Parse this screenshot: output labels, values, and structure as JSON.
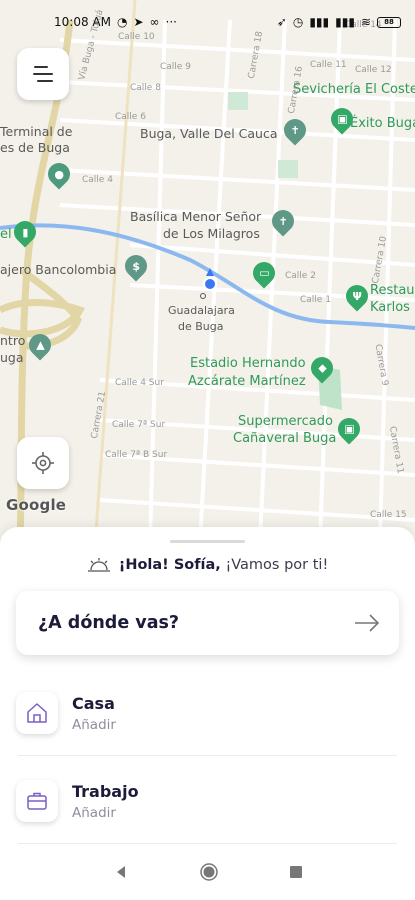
{
  "status": {
    "time": "10:08 AM",
    "battery": "88"
  },
  "map": {
    "labels": {
      "terminal": "Terminal de",
      "terminal2": "es de Buga",
      "buga_city": "Buga, Valle Del Cauca",
      "basilica1": "Basílica Menor Señor",
      "basilica2": "de Los Milagros",
      "cajero": "ajero Bancolombia",
      "guadalajara1": "Guadalajara",
      "guadalajara2": "de Buga",
      "estadio1": "Estadio Hernando",
      "estadio2": "Azcárate Martínez",
      "super1": "Supermercado",
      "super2": "Cañaveral Buga",
      "sevicheria": "Sevichería El Coste",
      "exito": "Éxito Buga",
      "restau1": "Restau",
      "restau2": "Karlos",
      "centro1": "ntro",
      "centro2": "uga",
      "el": "el"
    },
    "streets": {
      "calle10": "Calle 10",
      "calle9": "Calle 9",
      "calle8": "Calle 8",
      "calle6": "Calle 6",
      "calle4": "Calle 4",
      "calle2": "Calle 2",
      "calle1": "Calle 1",
      "calle4sur": "Calle 4 Sur",
      "calle7sur": "Calle 7ª Sur",
      "calle7bsur": "Calle 7ª B Sur",
      "calle11": "Calle 11",
      "calle12": "Calle 12",
      "calle14": "Calle 14",
      "calle15": "Calle 15",
      "carrera18": "Carrera 18",
      "carrera16": "Carrera 16",
      "carrera10": "Carrera 10",
      "carrera9": "Carrera 9",
      "carrera11": "Carrera 11",
      "carrera21": "Carrera 21",
      "via_buga": "Vía Buga - Tuluá"
    },
    "google": "Google"
  },
  "sheet": {
    "greeting_bold": "¡Hola! Sofía,",
    "greeting_rest": "¡Vamos por ti!",
    "search_label": "¿A dónde vas?",
    "places": [
      {
        "title": "Casa",
        "subtitle": "Añadir",
        "icon": "home-icon"
      },
      {
        "title": "Trabajo",
        "subtitle": "Añadir",
        "icon": "briefcase-icon"
      }
    ]
  },
  "colors": {
    "accent": "#7a5ec8",
    "map_green": "#34a867",
    "river": "#8cb8f0"
  }
}
